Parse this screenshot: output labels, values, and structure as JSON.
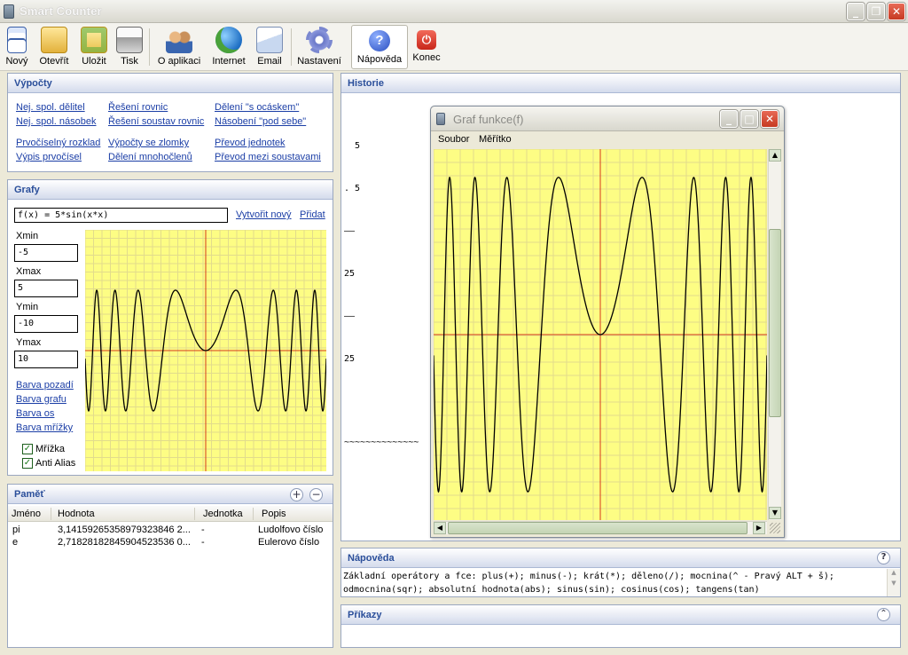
{
  "window": {
    "title": "Smart Counter"
  },
  "toolbar": {
    "items": [
      {
        "label": "Nový",
        "icon": "new-document-icon"
      },
      {
        "label": "Otevřít",
        "icon": "open-folder-icon"
      },
      {
        "label": "Uložit",
        "icon": "save-folder-icon"
      },
      {
        "label": "Tisk",
        "icon": "printer-icon"
      },
      {
        "label": "O aplikaci",
        "icon": "users-icon"
      },
      {
        "label": "Internet",
        "icon": "globe-icon"
      },
      {
        "label": "Email",
        "icon": "email-icon"
      },
      {
        "label": "Nastavení",
        "icon": "gear-icon"
      },
      {
        "label": "Nápověda",
        "icon": "help-icon"
      },
      {
        "label": "Konec",
        "icon": "power-icon"
      }
    ]
  },
  "vypocty": {
    "title": "Výpočty",
    "links": [
      "Nej. spol. dělitel",
      "Řešení rovnic",
      "Dělení \"s ocáskem\"",
      "Nej. spol. násobek",
      "Řešení soustav rovnic",
      "Násobení \"pod sebe\"",
      "Prvočíselný rozklad",
      "Výpočty se zlomky",
      "Převod jednotek",
      "Výpis prvočísel",
      "Dělení mnohočlenů",
      "Převod mezi soustavami"
    ]
  },
  "grafy": {
    "title": "Grafy",
    "function_value": "f(x) = 5*sin(x*x)",
    "create_new": "Vytvořit nový",
    "add": "Přidat",
    "xmin_label": "Xmin",
    "xmin": "-5",
    "xmax_label": "Xmax",
    "xmax": "5",
    "ymin_label": "Ymin",
    "ymin": "-10",
    "ymax_label": "Ymax",
    "ymax": "10",
    "links": [
      "Barva pozadí",
      "Barva grafu",
      "Barva os",
      "Barva mřížky"
    ],
    "grid_label": "Mřížka",
    "grid_checked": true,
    "antialias_label": "Anti Alias",
    "antialias_checked": true,
    "plot_bg": "#fdfd84",
    "grid_color": "#e2dc8c",
    "axis_color": "#d83a1a",
    "curve_color": "#000000"
  },
  "pamet": {
    "title": "Paměť",
    "columns": [
      "Jméno",
      "Hodnota",
      "Jednotka",
      "Popis"
    ],
    "rows": [
      [
        "pi",
        "3,14159265358979323846 2...",
        "-",
        "Ludolfovo číslo"
      ],
      [
        "e",
        "2,71828182845904523536 0...",
        "-",
        "Eulerovo číslo"
      ]
    ]
  },
  "historie": {
    "title": "Historie",
    "lines": [
      "  5",
      ". 5",
      "——",
      "25",
      "——",
      "25",
      "",
      "~~~~~~~~~~~~~~"
    ]
  },
  "graf_window": {
    "title": "Graf funkce(f)",
    "menu": [
      "Soubor",
      "Měřítko"
    ]
  },
  "napoveda": {
    "title": "Nápověda",
    "text": "Základní operátory a fce: plus(+); minus(-); krát(*); děleno(/); mocnina(^ - Pravý ALT + š); odmocnina(sqr); absolutní hodnota(abs); sinus(sin); cosinus(cos); tangens(tan)"
  },
  "prikazy": {
    "title": "Příkazy"
  }
}
